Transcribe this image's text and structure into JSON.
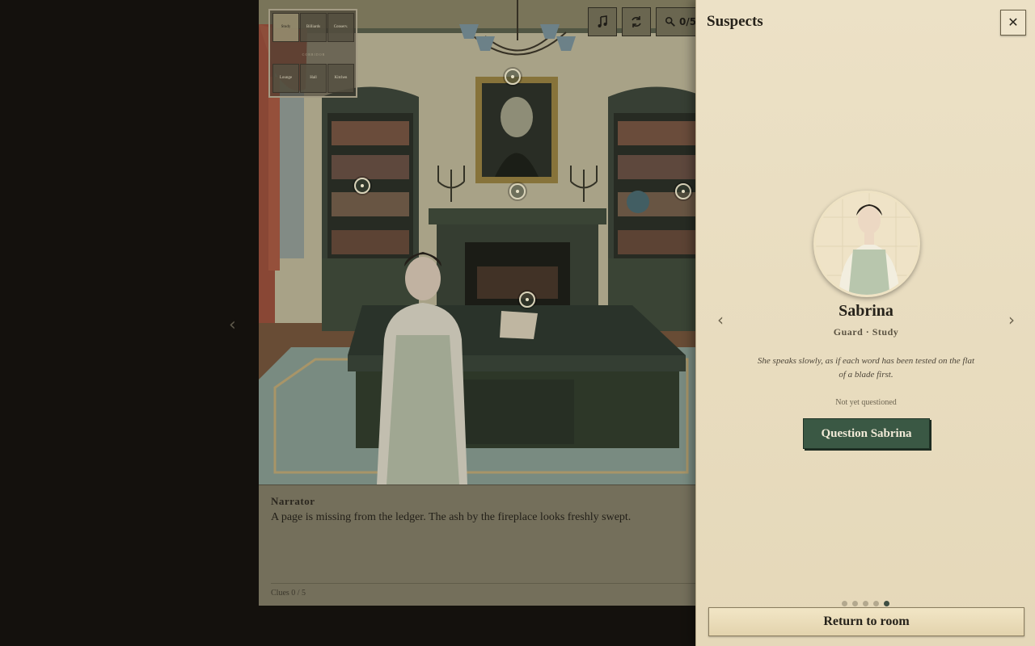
{
  "map": {
    "rooms_top": [
      "Study",
      "Billiards",
      "Conserv."
    ],
    "hall_label": "CORRIDOR",
    "rooms_bottom": [
      "Lounge",
      "Hall",
      "Kitchen"
    ]
  },
  "toolbar": {
    "music_icon": "music-note-icon",
    "refresh_icon": "refresh-icon",
    "clues_icon": "magnifier-icon",
    "clue_count": "0/5"
  },
  "dialogue": {
    "speaker": "Narrator",
    "text": "A page is missing from the ledger. The ash by the fireplace looks freshly swept.",
    "clue_progress": "Clues 0 / 5"
  },
  "panel": {
    "title": "Suspects",
    "close_label": "✕",
    "prev_label": "‹",
    "next_label": "›",
    "suspect": {
      "name": "Sabrina",
      "role": "Guard · Study",
      "quote": "She speaks slowly, as if each word has been tested on the flat of a blade first.",
      "status": "Not yet questioned",
      "question_button": "Question Sabrina"
    },
    "pagination": {
      "total": 5,
      "active_index": 4
    },
    "return_button": "Return to room"
  },
  "colors": {
    "panel_bg": "#ece1c6",
    "accent_green": "#3a5844",
    "scene_wall": "#c7c1a3",
    "rug_teal": "#8aa79e"
  }
}
